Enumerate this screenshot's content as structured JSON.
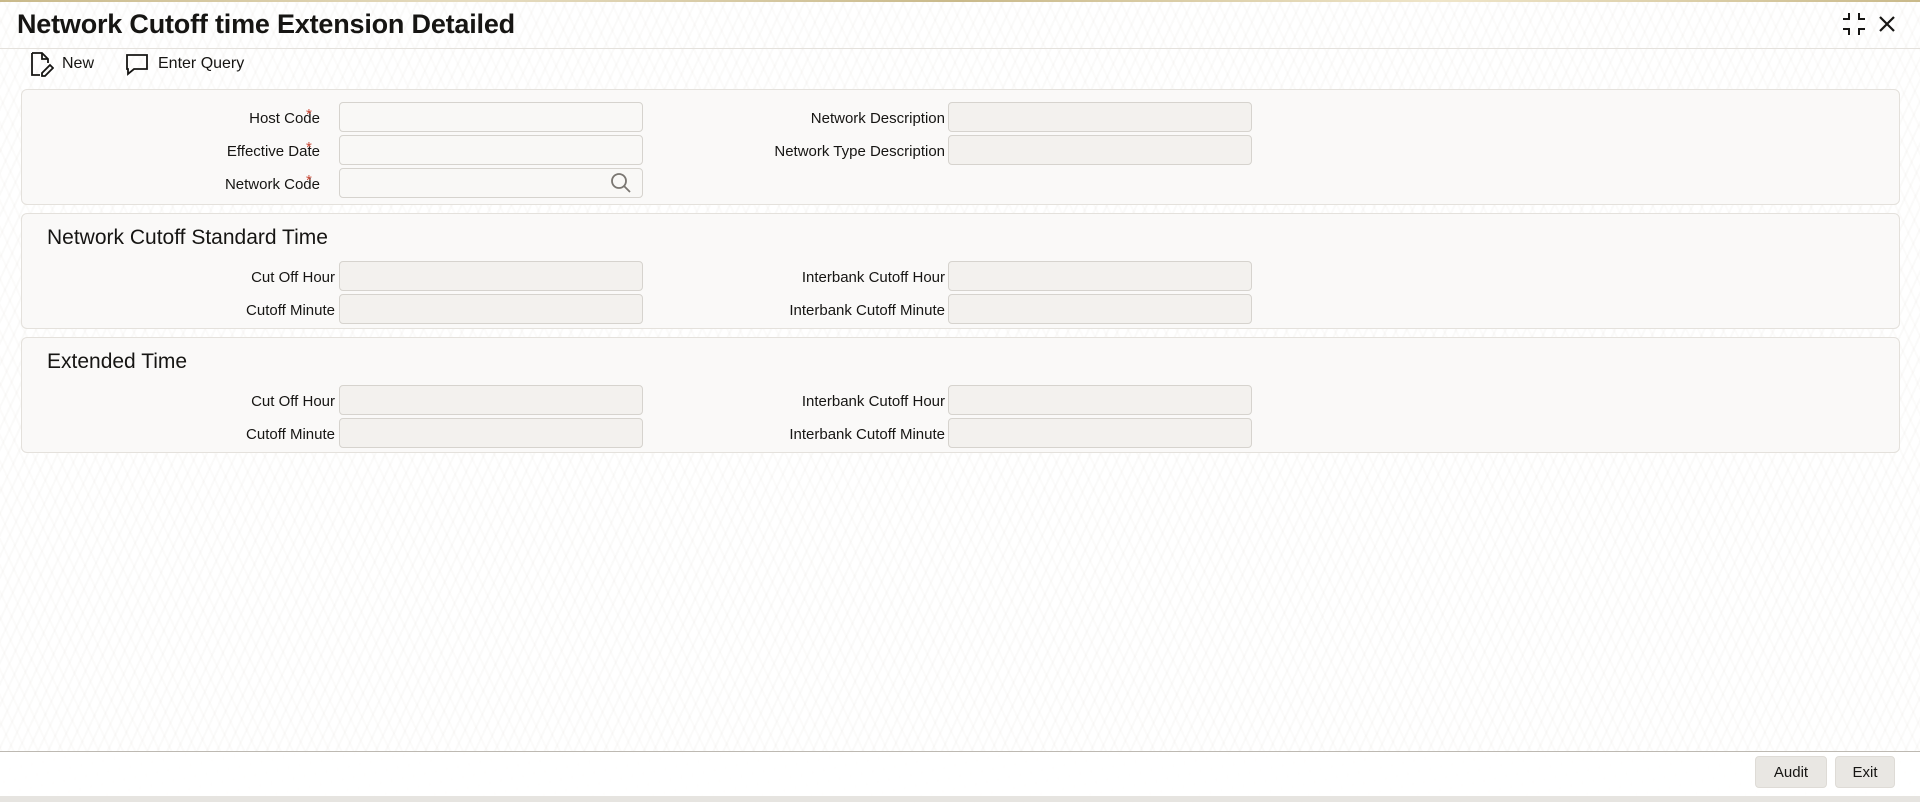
{
  "window": {
    "title": "Network Cutoff time Extension Detailed",
    "maximize_icon": "maximize-icon",
    "close_icon": "close-icon"
  },
  "toolbar": {
    "new_label": "New",
    "new_icon": "new-document-icon",
    "enter_query_label": "Enter Query",
    "enter_query_icon": "speech-bubble-icon"
  },
  "header_section": {
    "host_code": {
      "label": "Host Code",
      "required_mark": "*",
      "value": ""
    },
    "effective_date": {
      "label": "Effective Date",
      "required_mark": "*",
      "value": ""
    },
    "network_code": {
      "label": "Network Code",
      "required_mark": "*",
      "value": "",
      "lookup_icon": "search-icon"
    },
    "network_description": {
      "label": "Network Description",
      "value": ""
    },
    "network_type_description": {
      "label": "Network Type Description",
      "value": ""
    }
  },
  "standard_time": {
    "title": "Network Cutoff Standard Time",
    "cut_off_hour": {
      "label": "Cut Off Hour",
      "value": ""
    },
    "cutoff_minute": {
      "label": "Cutoff Minute",
      "value": ""
    },
    "interbank_cutoff_hour": {
      "label": "Interbank Cutoff Hour",
      "value": ""
    },
    "interbank_cutoff_minute": {
      "label": "Interbank Cutoff Minute",
      "value": ""
    }
  },
  "extended_time": {
    "title": "Extended Time",
    "cut_off_hour": {
      "label": "Cut Off Hour",
      "value": ""
    },
    "cutoff_minute": {
      "label": "Cutoff Minute",
      "value": ""
    },
    "interbank_cutoff_hour": {
      "label": "Interbank Cutoff Hour",
      "value": ""
    },
    "interbank_cutoff_minute": {
      "label": "Interbank Cutoff Minute",
      "value": ""
    }
  },
  "footer": {
    "audit_label": "Audit",
    "exit_label": "Exit"
  },
  "colors": {
    "required": "#c74634",
    "text": "#161513",
    "panel_border": "#e4e1dc"
  }
}
